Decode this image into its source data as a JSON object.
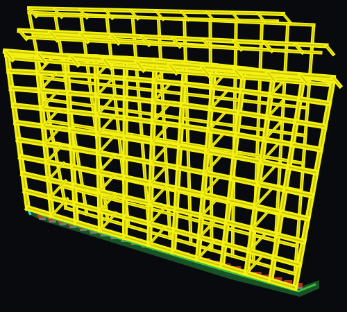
{
  "viewport": {
    "background": "#080a0d",
    "model": {
      "type": "structural-frame",
      "frame_color": "#f5f211",
      "frame_edge_color": "#bdb608",
      "base_colors": {
        "slab": "#3fbf3f",
        "supports": "#d43a2a",
        "mesh": "#8a8a8a",
        "edge_highlight": "#37d7e0"
      }
    }
  }
}
